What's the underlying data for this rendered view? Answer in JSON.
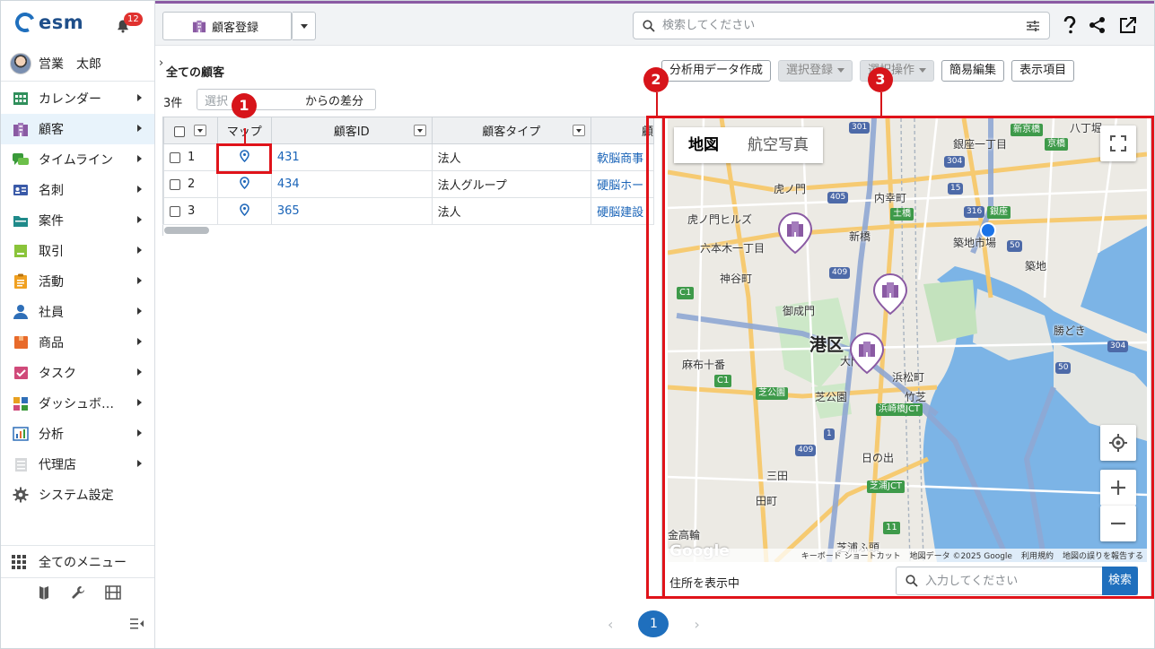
{
  "app": {
    "logo_text": "esm",
    "notification_count": "12"
  },
  "user": {
    "name": "営業　太郎"
  },
  "sidebar": {
    "items": [
      {
        "label": "カレンダー",
        "icon": "calendar-icon",
        "color": "#2f8f5b"
      },
      {
        "label": "顧客",
        "icon": "building-icon",
        "color": "#8a5aa3"
      },
      {
        "label": "タイムライン",
        "icon": "chat-icon",
        "color": "#3a9a3a"
      },
      {
        "label": "名刺",
        "icon": "card-icon",
        "color": "#3a5aa8"
      },
      {
        "label": "案件",
        "icon": "folder-icon",
        "color": "#1f8a8a"
      },
      {
        "label": "取引",
        "icon": "deal-icon",
        "color": "#8ac43a"
      },
      {
        "label": "活動",
        "icon": "clipboard-icon",
        "color": "#f0a020"
      },
      {
        "label": "社員",
        "icon": "person-icon",
        "color": "#2f6fb8"
      },
      {
        "label": "商品",
        "icon": "box-icon",
        "color": "#e86a2a"
      },
      {
        "label": "タスク",
        "icon": "task-icon",
        "color": "#d04a7a"
      },
      {
        "label": "ダッシュボ…",
        "icon": "dashboard-icon",
        "color": "#e8a020"
      },
      {
        "label": "分析",
        "icon": "analysis-icon",
        "color": "#2f6fb8"
      },
      {
        "label": "代理店",
        "icon": "agency-icon",
        "color": "#bbbbbb"
      },
      {
        "label": "システム設定",
        "icon": "gear-icon",
        "color": "#555555"
      }
    ],
    "all_menu": "全てのメニュー"
  },
  "topbar": {
    "register_label": "顧客登録",
    "search_placeholder": "検索してください"
  },
  "main": {
    "title": "全ての顧客",
    "actions": {
      "analysis_data": "分析用データ作成",
      "select_register": "選択登録",
      "select_operation": "選択操作",
      "quick_edit": "簡易編集",
      "display_items": "表示項目"
    },
    "count": "3件",
    "diff_placeholder": "選択",
    "diff_suffix": "からの差分",
    "columns": [
      "マップ",
      "顧客ID",
      "顧客タイプ",
      "顧"
    ],
    "rows": [
      {
        "num": "1",
        "id": "431",
        "type": "法人",
        "name": "軟脳商事"
      },
      {
        "num": "2",
        "id": "434",
        "type": "法人グループ",
        "name": "硬脳ホー"
      },
      {
        "num": "3",
        "id": "365",
        "type": "法人",
        "name": "硬脳建設"
      }
    ]
  },
  "callouts": [
    "1",
    "2",
    "3"
  ],
  "map": {
    "tabs": [
      "地図",
      "航空写真"
    ],
    "labels": {
      "ward": "港区",
      "ginza": "銀座一丁目",
      "hatchobori": "八丁堀",
      "toranomon": "虎ノ門",
      "uchisaiwai": "内幸町",
      "toranomon_hills": "虎ノ門ヒルズ",
      "shinbashi": "新橋",
      "tsukiji_market": "築地市場",
      "tsukiji": "築地",
      "roppongi": "六本木一丁目",
      "kamiyacho": "神谷町",
      "onarimon": "御成門",
      "daimon": "大門",
      "hamamatsucho": "浜松町",
      "azabu": "麻布十番",
      "shibakoen": "芝公園",
      "takeshiba": "竹芝",
      "kachidoki": "勝どき",
      "hinode": "日の出",
      "mita": "三田",
      "tamachi": "田町",
      "kanasugi": "金高輪",
      "shibaura": "芝浦ふ頭",
      "shiba_park_tag": "芝公園",
      "dobashi": "土橋",
      "ginza_tag": "銀座",
      "shinkyo": "新京橋",
      "kyobashi": "京橋",
      "hamazaki_jct": "浜崎橋JCT",
      "shibaura_jct": "芝浦JCT"
    },
    "road_numbers": [
      "301",
      "304",
      "405",
      "15",
      "316",
      "50",
      "409",
      "C1",
      "50",
      "304",
      "409",
      "C1",
      "11",
      "1"
    ],
    "footer": {
      "shortcuts": "キーボード ショートカット",
      "copyright": "地図データ ©2025 Google",
      "terms": "利用規約",
      "report": "地図の誤りを報告する"
    },
    "google_logo": "Google",
    "status": "住所を表示中",
    "search_placeholder": "入力してください",
    "search_button": "検索"
  },
  "pagination": {
    "current": "1",
    "prev": "‹",
    "next": "›"
  },
  "colors": {
    "accent": "#8a5aa3",
    "link": "#1a64b8",
    "primary": "#1f6fbd",
    "callout": "#d7141a"
  }
}
